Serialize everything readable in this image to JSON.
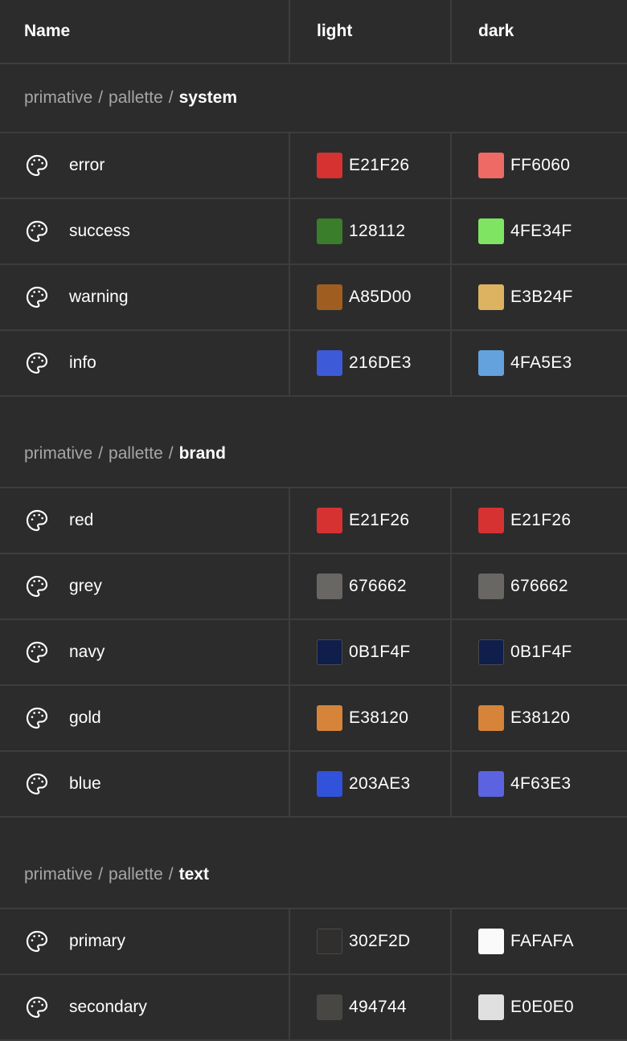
{
  "header": {
    "name": "Name",
    "light": "light",
    "dark": "dark"
  },
  "groups": [
    {
      "path": [
        "primative",
        "pallette"
      ],
      "last": "system",
      "rows": [
        {
          "name": "error",
          "light": {
            "hex": "E21F26",
            "color": "#D63232"
          },
          "dark": {
            "hex": "FF6060",
            "color": "#EE6A65"
          }
        },
        {
          "name": "success",
          "light": {
            "hex": "128112",
            "color": "#3A7D2A"
          },
          "dark": {
            "hex": "4FE34F",
            "color": "#7EE462"
          }
        },
        {
          "name": "warning",
          "light": {
            "hex": "A85D00",
            "color": "#A05D20"
          },
          "dark": {
            "hex": "E3B24F",
            "color": "#DDB260"
          }
        },
        {
          "name": "info",
          "light": {
            "hex": "216DE3",
            "color": "#3D5BD8"
          },
          "dark": {
            "hex": "4FA5E3",
            "color": "#64A2DE"
          }
        }
      ]
    },
    {
      "path": [
        "primative",
        "pallette"
      ],
      "last": "brand",
      "rows": [
        {
          "name": "red",
          "light": {
            "hex": "E21F26",
            "color": "#D63232"
          },
          "dark": {
            "hex": "E21F26",
            "color": "#D63232"
          }
        },
        {
          "name": "grey",
          "light": {
            "hex": "676662",
            "color": "#686764"
          },
          "dark": {
            "hex": "676662",
            "color": "#686764"
          }
        },
        {
          "name": "navy",
          "light": {
            "hex": "0B1F4F",
            "color": "#0F1E4A"
          },
          "dark": {
            "hex": "0B1F4F",
            "color": "#0F1E4A"
          }
        },
        {
          "name": "gold",
          "light": {
            "hex": "E38120",
            "color": "#D5843A"
          },
          "dark": {
            "hex": "E38120",
            "color": "#D5843A"
          }
        },
        {
          "name": "blue",
          "light": {
            "hex": "203AE3",
            "color": "#3152DA"
          },
          "dark": {
            "hex": "4F63E3",
            "color": "#5B63E0"
          }
        }
      ]
    },
    {
      "path": [
        "primative",
        "pallette"
      ],
      "last": "text",
      "rows": [
        {
          "name": "primary",
          "light": {
            "hex": "302F2D",
            "color": "#302F2D"
          },
          "dark": {
            "hex": "FAFAFA",
            "color": "#FAFAFA"
          }
        },
        {
          "name": "secondary",
          "light": {
            "hex": "494744",
            "color": "#494744"
          },
          "dark": {
            "hex": "E0E0E0",
            "color": "#E0E0E0"
          }
        }
      ]
    }
  ],
  "icons": {
    "row_icon": "palette-icon"
  },
  "colors": {
    "background": "#2c2c2c",
    "divider": "#3d3d3d",
    "muted_text": "#a6a6a6"
  }
}
